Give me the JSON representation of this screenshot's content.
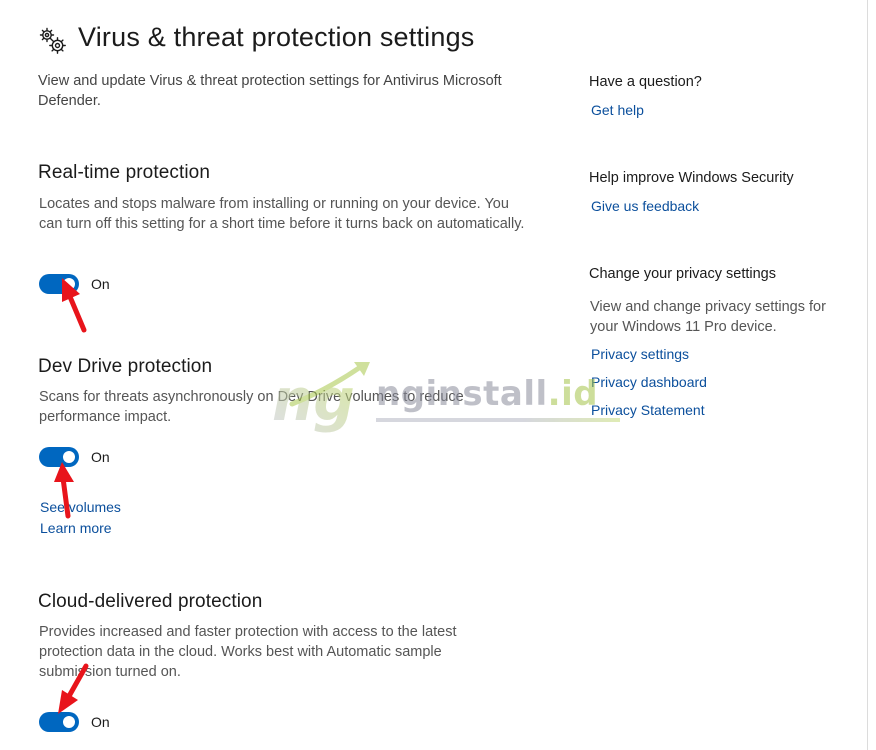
{
  "header": {
    "title": "Virus & threat protection settings",
    "icon": "gear-icon",
    "intro": "View and update Virus & threat protection settings for Antivirus Microsoft Defender."
  },
  "sections": [
    {
      "title": "Real-time protection",
      "description": "Locates and stops malware from installing or running on your device. You can turn off this setting for a short time before it turns back on automatically.",
      "toggle_label": "On",
      "toggle_on": true
    },
    {
      "title": "Dev Drive protection",
      "description": "Scans for threats asynchronously on Dev Drive volumes to reduce performance impact.",
      "toggle_label": "On",
      "toggle_on": true,
      "links": [
        "See volumes",
        "Learn more"
      ]
    },
    {
      "title": "Cloud-delivered protection",
      "description": "Provides increased and faster protection with access to the latest protection data in the cloud. Works best with Automatic sample submission turned on.",
      "toggle_label": "On",
      "toggle_on": true
    }
  ],
  "sidebar": {
    "question": {
      "heading": "Have a question?",
      "link": "Get help"
    },
    "improve": {
      "heading": "Help improve Windows Security",
      "link": "Give us feedback"
    },
    "privacy": {
      "heading": "Change your privacy settings",
      "description": "View and change privacy settings for your Windows 11 Pro device.",
      "links": [
        "Privacy settings",
        "Privacy dashboard",
        "Privacy Statement"
      ]
    }
  },
  "watermark": {
    "logo_letters": "ng",
    "text_main": "nginstall",
    "text_accent": ".id"
  },
  "colors": {
    "accent": "#0067c0",
    "link": "#0b4f9c",
    "annotation_arrow": "#e8141b"
  }
}
